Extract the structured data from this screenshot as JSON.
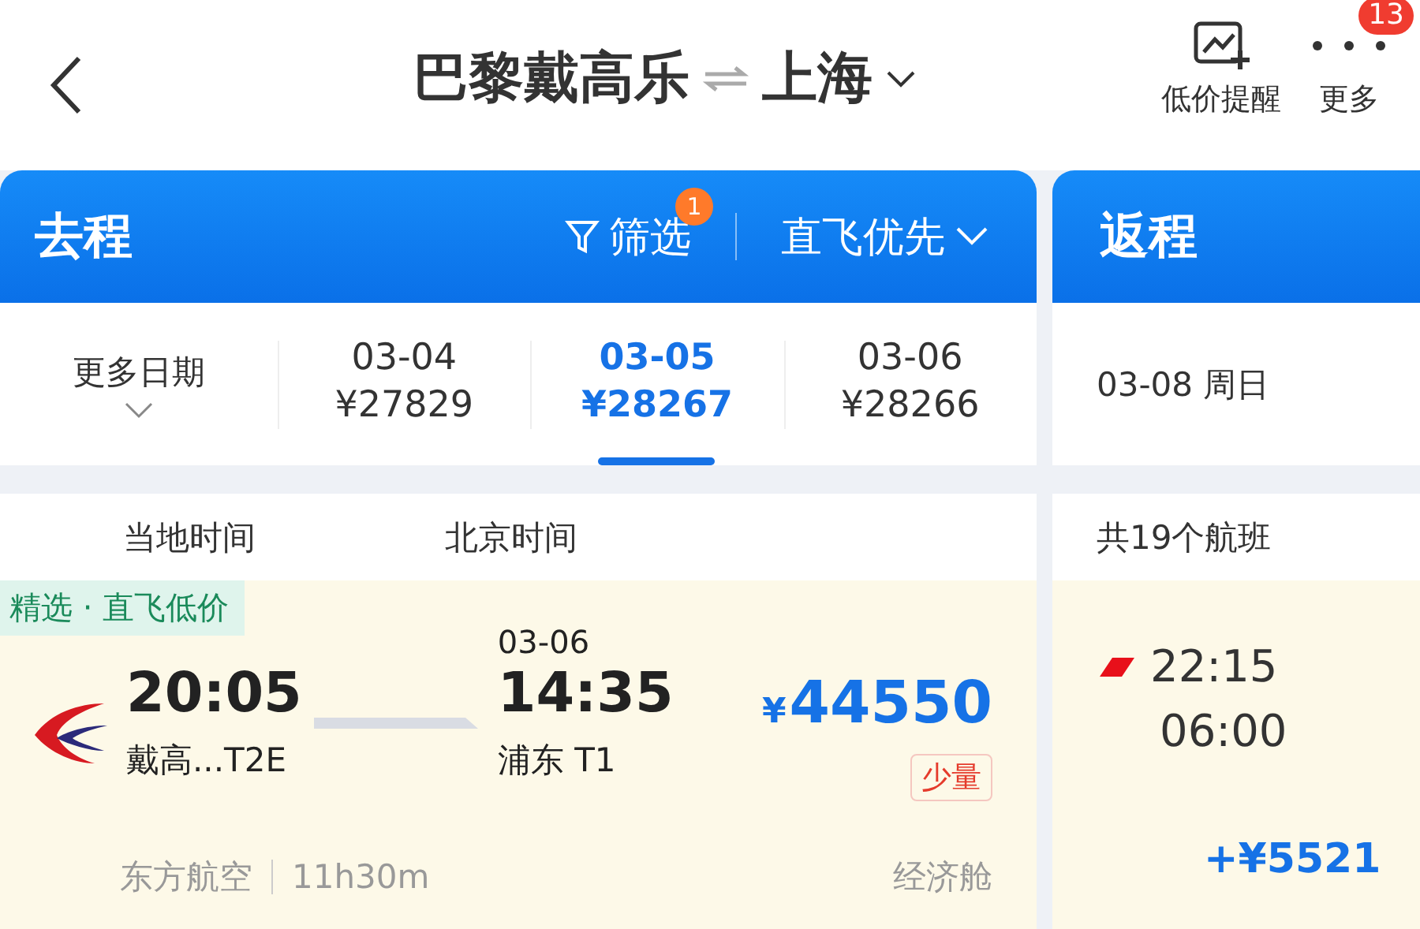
{
  "header": {
    "from": "巴黎戴高乐",
    "to": "上海",
    "actions": [
      {
        "label": "低价提醒",
        "kind": "chart"
      },
      {
        "label": "更多",
        "kind": "more",
        "badge": "13"
      }
    ]
  },
  "outbound": {
    "title": "去程",
    "filter": {
      "label": "筛选",
      "badge": "1"
    },
    "sort": "直飞优先",
    "more_dates": "更多日期",
    "dates": [
      {
        "date": "03-04",
        "price": "¥27829",
        "selected": false
      },
      {
        "date": "03-05",
        "price": "¥28267",
        "selected": true
      },
      {
        "date": "03-06",
        "price": "¥28266",
        "selected": false
      }
    ],
    "columns": [
      "当地时间",
      "北京时间"
    ],
    "flight": {
      "tag": "精选 · 直飞低价",
      "depart_time": "20:05",
      "depart_airport": "戴高...T2E",
      "arrive_date": "03-06",
      "arrive_time": "14:35",
      "arrive_airport": "浦东 T1",
      "currency": "¥",
      "price": "44550",
      "stock": "少量",
      "airline": "东方航空",
      "duration": "11h30m",
      "cabin": "经济舱"
    }
  },
  "return": {
    "title": "返程",
    "date": "03-08 周日",
    "count": "共19个航班",
    "flight": {
      "depart_time": "22:15",
      "arrive_time": "06:00",
      "extra": "+¥5521"
    }
  }
}
